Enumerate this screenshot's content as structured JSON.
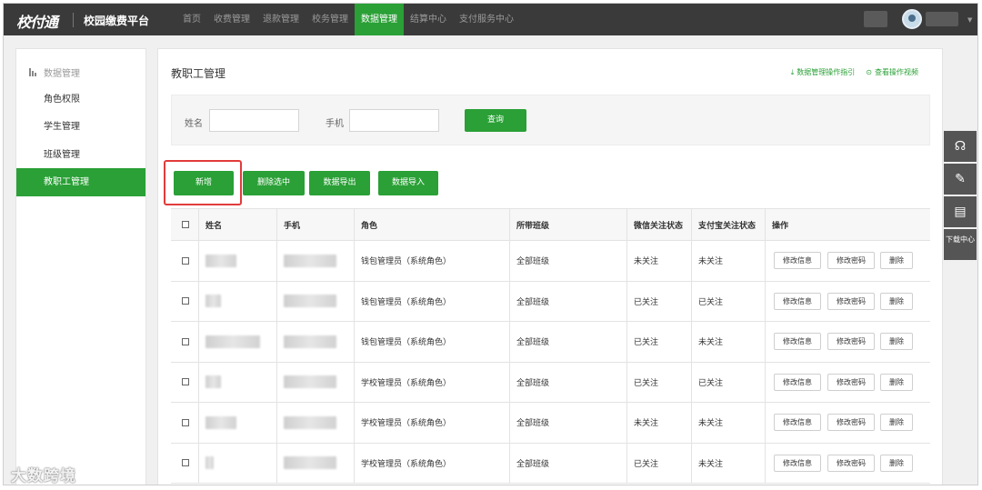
{
  "topbar": {
    "logo": "校付通",
    "platform": "校园缴费平台",
    "nav": [
      "首页",
      "收费管理",
      "退款管理",
      "校务管理",
      "数据管理",
      "结算中心",
      "支付服务中心"
    ],
    "active_nav": "数据管理"
  },
  "sidebar": {
    "heading": "数据管理",
    "items": [
      "角色权限",
      "学生管理",
      "班级管理",
      "教职工管理"
    ],
    "active": "教职工管理"
  },
  "main": {
    "title": "教职工管理",
    "links": [
      "数据管理操作指引",
      "查看操作视频"
    ]
  },
  "search": {
    "name_label": "姓名",
    "name_value": "",
    "phone_label": "手机",
    "phone_value": "",
    "query_button": "查询"
  },
  "actions": {
    "add": "新增",
    "delete_selected": "删除选中",
    "export": "数据导出",
    "import": "数据导入"
  },
  "table": {
    "headers": [
      "姓名",
      "手机",
      "角色",
      "所带班级",
      "微信关注状态",
      "支付宝关注状态",
      "操作"
    ],
    "op_buttons": [
      "修改信息",
      "修改密码",
      "删除"
    ],
    "rows": [
      {
        "role": "钱包管理员（系统角色）",
        "classes": "全部班级",
        "wechat": "未关注",
        "alipay": "未关注"
      },
      {
        "role": "钱包管理员（系统角色）",
        "classes": "全部班级",
        "wechat": "已关注",
        "alipay": "已关注"
      },
      {
        "role": "钱包管理员（系统角色）",
        "classes": "全部班级",
        "wechat": "已关注",
        "alipay": "未关注"
      },
      {
        "role": "学校管理员（系统角色）",
        "classes": "全部班级",
        "wechat": "已关注",
        "alipay": "已关注"
      },
      {
        "role": "学校管理员（系统角色）",
        "classes": "全部班级",
        "wechat": "未关注",
        "alipay": "未关注"
      },
      {
        "role": "学校管理员（系统角色）",
        "classes": "全部班级",
        "wechat": "已关注",
        "alipay": "未关注"
      }
    ]
  },
  "float_bar": {
    "download_center": "下载中心"
  },
  "watermark": "大数跨境",
  "colors": {
    "accent": "#2aa036",
    "topbar": "#3a3a3a",
    "highlight": "#e23b3b"
  }
}
